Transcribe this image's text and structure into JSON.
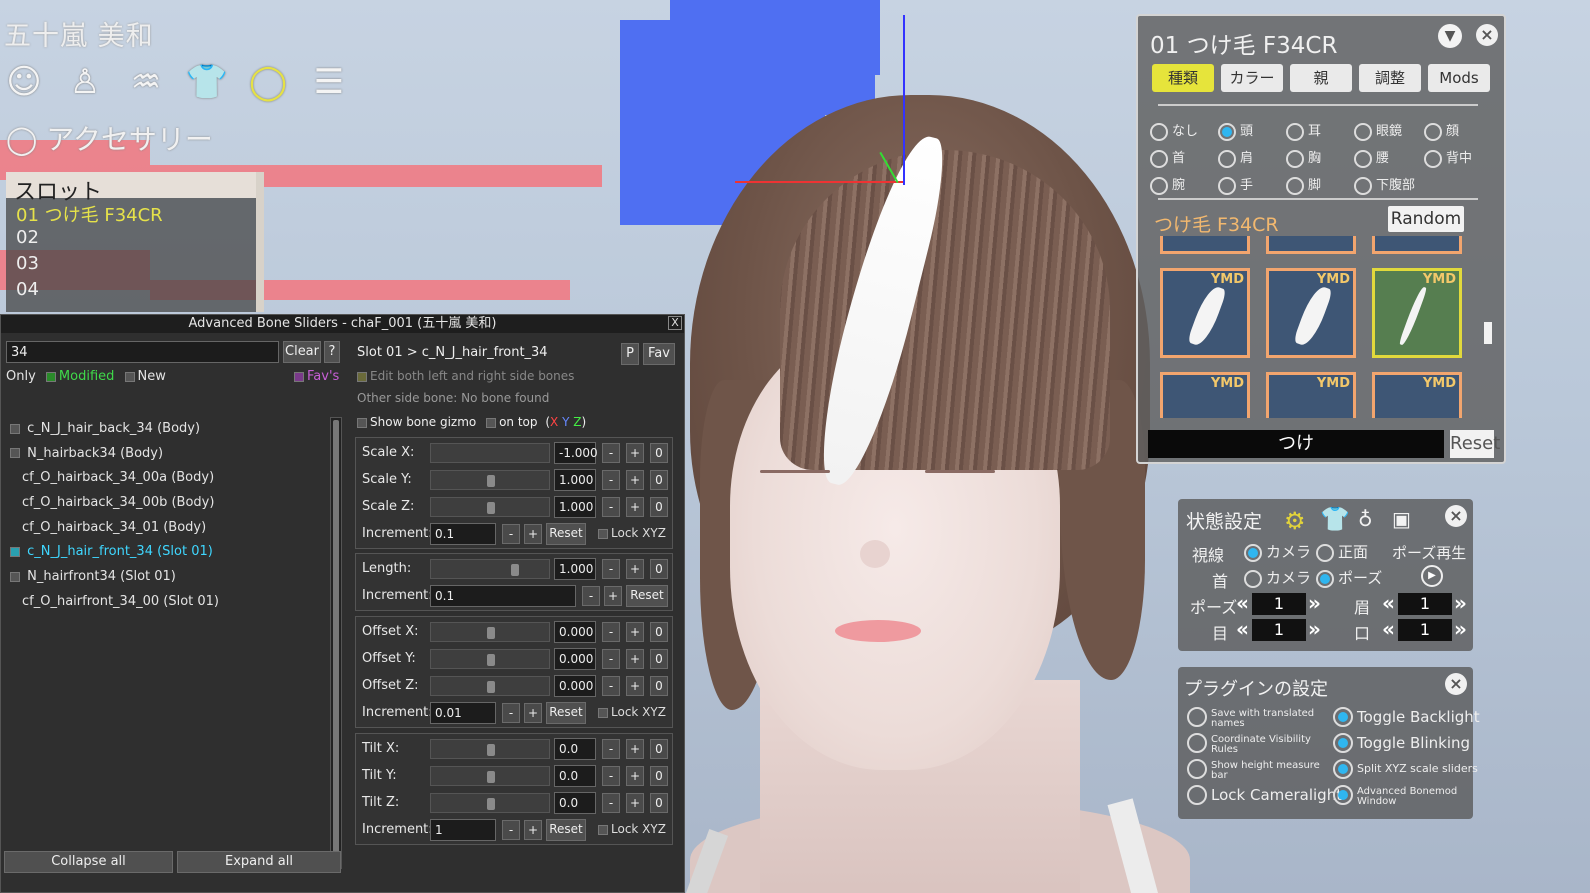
{
  "character_name": "五十嵐 美和",
  "category_icons": [
    "face-icon",
    "body-icon",
    "hair-icon",
    "clothing-icon",
    "accessory-ring-icon",
    "list-icon"
  ],
  "accessory_label": "アクセサリー",
  "slots": {
    "header": "スロット",
    "items": [
      "01 つけ毛 F34CR",
      "02",
      "03",
      "04"
    ]
  },
  "abs": {
    "title": "Advanced Bone Sliders - chaF_001 (五十嵐 美和)",
    "close": "X",
    "search_value": "34",
    "clear": "Clear",
    "help": "?",
    "only": "Only",
    "modified": "Modified",
    "new": "New",
    "favs": "Fav's",
    "tree": [
      "c_N_J_hair_back_34 (Body)",
      "N_hairback34 (Body)",
      "cf_O_hairback_34_00a (Body)",
      "cf_O_hairback_34_00b (Body)",
      "cf_O_hairback_34_01 (Body)",
      "c_N_J_hair_front_34 (Slot 01)",
      "N_hairfront34 (Slot 01)",
      "cf_O_hairfront_34_00 (Slot 01)"
    ],
    "collapse_all": "Collapse all",
    "expand_all": "Expand all",
    "path": "Slot 01 > c_N_J_hair_front_34",
    "p": "P",
    "fav": "Fav",
    "edit_both": "Edit both left and right side bones",
    "other_side": "Other side bone: No bone found",
    "show_gizmo": "Show bone gizmo",
    "on_top": "on top",
    "xyz": [
      "X",
      "Y",
      "Z"
    ],
    "scale": [
      {
        "label": "Scale X:",
        "value": "-1.000"
      },
      {
        "label": "Scale Y:",
        "value": "1.000"
      },
      {
        "label": "Scale Z:",
        "value": "1.000"
      }
    ],
    "scale_increment": "0.1",
    "length": {
      "label": "Length:",
      "value": "1.000"
    },
    "length_increment": "0.1",
    "offset": [
      {
        "label": "Offset X:",
        "value": "0.000"
      },
      {
        "label": "Offset Y:",
        "value": "0.000"
      },
      {
        "label": "Offset Z:",
        "value": "0.000"
      }
    ],
    "offset_increment": "0.01",
    "tilt": [
      {
        "label": "Tilt X:",
        "value": "0.0"
      },
      {
        "label": "Tilt Y:",
        "value": "0.0"
      },
      {
        "label": "Tilt Z:",
        "value": "0.0"
      }
    ],
    "tilt_increment": "1",
    "increment_label": "Increment:",
    "reset": "Reset",
    "lock_xyz": "Lock XYZ",
    "minus": "-",
    "plus": "+",
    "zero": "0"
  },
  "acc_panel": {
    "title": "01 つけ毛 F34CR",
    "tabs": [
      "種類",
      "カラー",
      "親",
      "調整",
      "Mods"
    ],
    "parents": [
      [
        "なし",
        "頭",
        "耳",
        "眼鏡",
        "顔"
      ],
      [
        "首",
        "肩",
        "胸",
        "腰",
        "背中"
      ],
      [
        "腕",
        "手",
        "脚",
        "下腹部"
      ]
    ],
    "selected_parent": "頭",
    "item_name": "つけ毛 F34CR",
    "random": "Random",
    "thumb_tag": "YMD",
    "filter_value": "つけ",
    "reset": "Reset"
  },
  "state_panel": {
    "title": "状態設定",
    "gaze_label": "視線",
    "neck_label": "首",
    "camera": "カメラ",
    "front": "正面",
    "pose": "ポーズ",
    "pose_play": "ポーズ再生",
    "pose_label": "ポーズ",
    "brow_label": "眉",
    "eye_label": "目",
    "mouth_label": "口",
    "pose_value": "1",
    "brow_value": "1",
    "eye_value": "1",
    "mouth_value": "1"
  },
  "plugin_panel": {
    "title": "プラグインの設定",
    "left": [
      "Save with translated names",
      "Coordinate Visibility Rules",
      "Show height measure bar",
      "Lock Cameralight"
    ],
    "right": [
      "Toggle Backlight",
      "Toggle Blinking",
      "Split XYZ scale sliders",
      "Advanced Bonemod Window"
    ]
  },
  "colors": {
    "accent_yellow": "#e6e43b",
    "selection_cyan": "#3fd7ff",
    "radio_blue": "#2fb6f0",
    "gizmo_blue": "#4f6ff2"
  }
}
